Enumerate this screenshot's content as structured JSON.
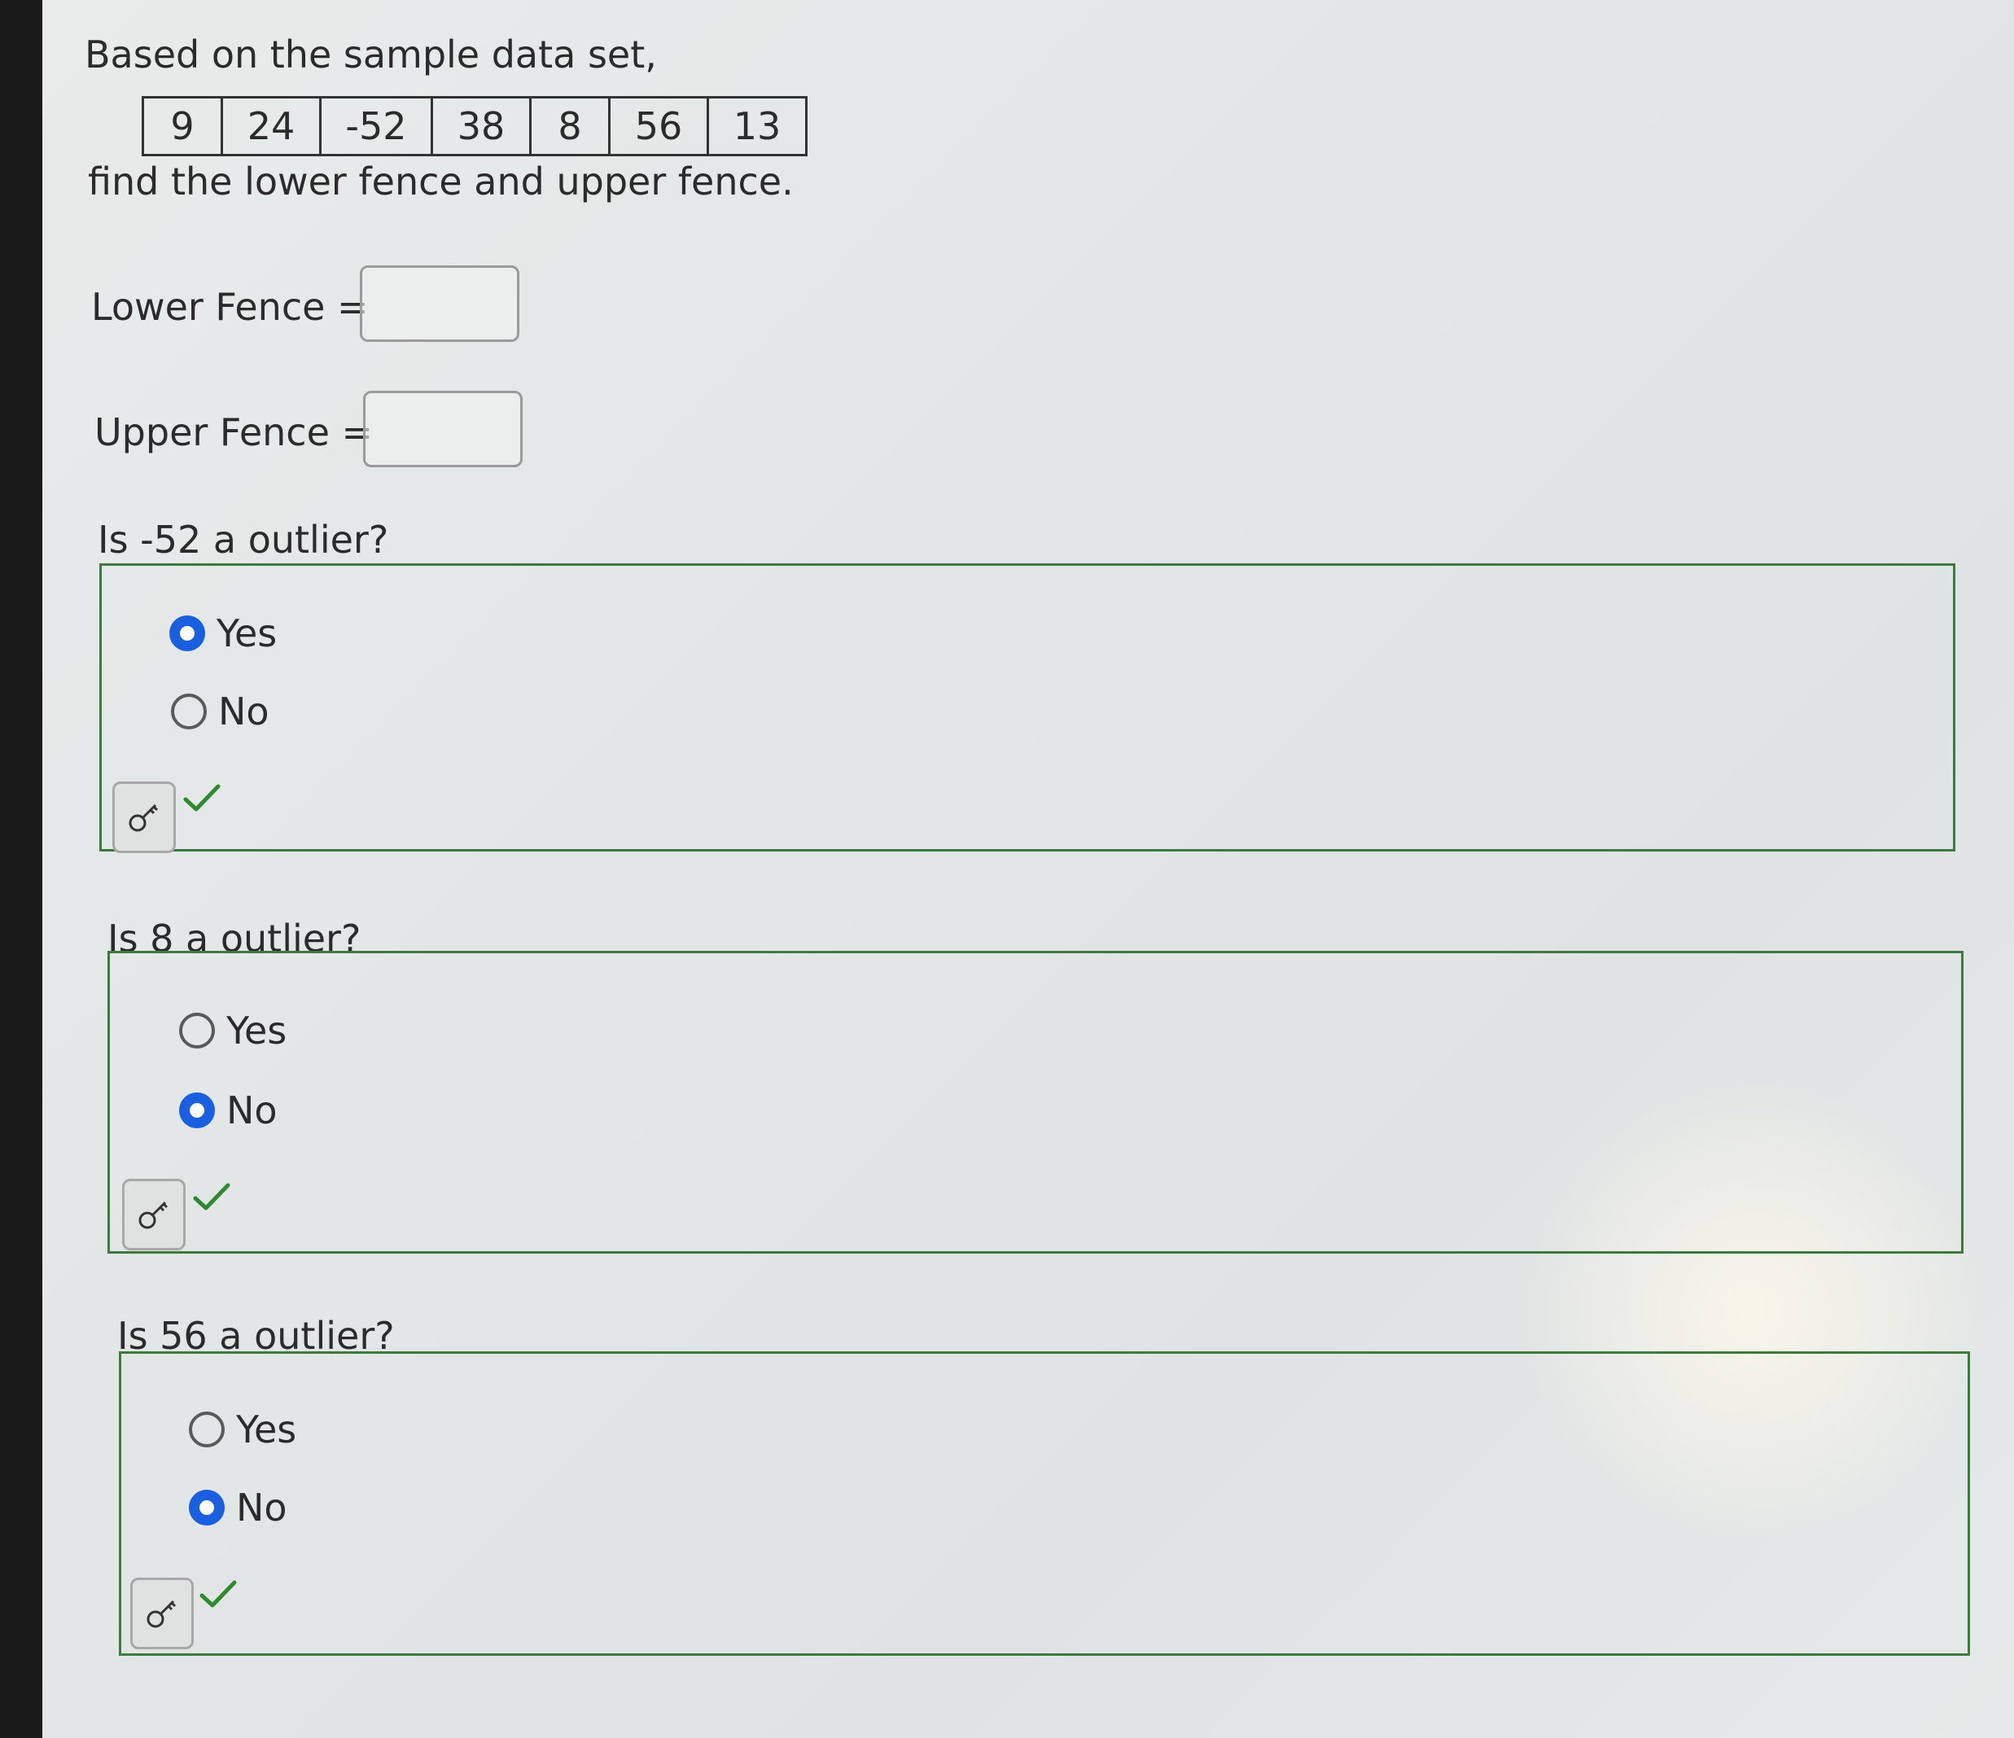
{
  "intro_text": "Based on the sample data set,",
  "data_values": [
    "9",
    "24",
    "-52",
    "38",
    "8",
    "56",
    "13"
  ],
  "instruction_text": "find the lower fence and upper fence.",
  "lower_fence": {
    "label": "Lower Fence =",
    "value": ""
  },
  "upper_fence": {
    "label": "Upper Fence =",
    "value": ""
  },
  "questions": [
    {
      "prompt": "Is -52 a outlier?",
      "options": [
        "Yes",
        "No"
      ],
      "selected": "Yes",
      "correct": true
    },
    {
      "prompt": "Is 8 a outlier?",
      "options": [
        "Yes",
        "No"
      ],
      "selected": "No",
      "correct": true
    },
    {
      "prompt": "Is 56 a outlier?",
      "options": [
        "Yes",
        "No"
      ],
      "selected": "No",
      "correct": true
    }
  ],
  "icons": {
    "hint": "key-icon",
    "status": "checkmark-icon"
  },
  "colors": {
    "selected_radio": "#1a5fe0",
    "box_border": "#3d7a3d",
    "checkmark": "#2f8a2f"
  }
}
